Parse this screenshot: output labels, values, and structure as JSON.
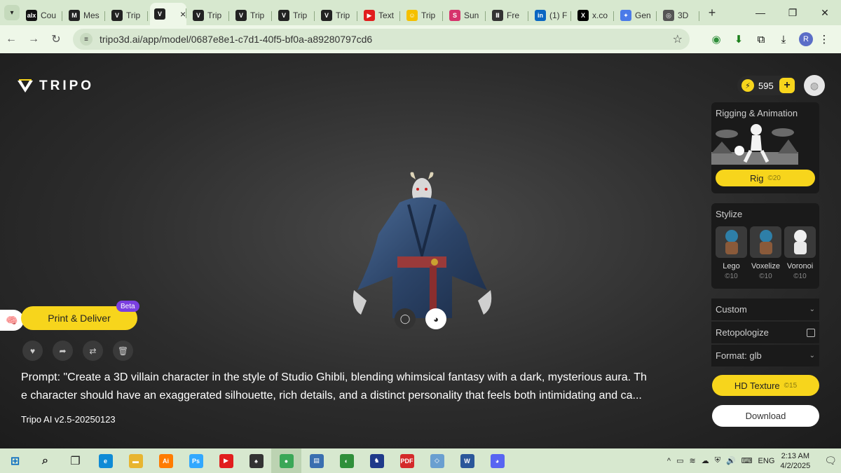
{
  "browser": {
    "tabs": [
      {
        "label": "Cou",
        "favicon": "alx",
        "color": "#111111"
      },
      {
        "label": "Mes",
        "favicon": "M",
        "color": "#222222"
      },
      {
        "label": "Trip",
        "favicon": "V",
        "color": "#222222"
      },
      {
        "label": "",
        "favicon": "V",
        "color": "#222222",
        "active": true
      },
      {
        "label": "Trip",
        "favicon": "V",
        "color": "#222222"
      },
      {
        "label": "Trip",
        "favicon": "V",
        "color": "#222222"
      },
      {
        "label": "Trip",
        "favicon": "V",
        "color": "#222222"
      },
      {
        "label": "Trip",
        "favicon": "V",
        "color": "#222222"
      },
      {
        "label": "Text",
        "favicon": "▶",
        "color": "#e11d1d"
      },
      {
        "label": "Trip",
        "favicon": "☺",
        "color": "#f5c000"
      },
      {
        "label": "Sun",
        "favicon": "S",
        "color": "#d6336c"
      },
      {
        "label": "Fre",
        "favicon": "Ⅱ",
        "color": "#333333"
      },
      {
        "label": "(1) F",
        "favicon": "in",
        "color": "#0a66c2"
      },
      {
        "label": "x.co",
        "favicon": "X",
        "color": "#000000"
      },
      {
        "label": "Gen",
        "favicon": "✦",
        "color": "#4a7ae8"
      },
      {
        "label": "3D",
        "favicon": "◎",
        "color": "#555555"
      }
    ],
    "tab_close": "×",
    "new_tab": "+",
    "url": "tripo3d.ai/app/model/0687e8e1-c7d1-40f5-bf0a-a89280797cd6",
    "profile_initial": "R"
  },
  "app": {
    "logo_text": "TRIPO",
    "credits": "595",
    "plus_label": "+",
    "rigging": {
      "title": "Rigging & Animation",
      "button": "Rig",
      "cost": "©20"
    },
    "stylize": {
      "title": "Stylize",
      "items": [
        {
          "label": "Lego",
          "cost": "©10"
        },
        {
          "label": "Voxelize",
          "cost": "©10"
        },
        {
          "label": "Voronoi",
          "cost": "©10"
        }
      ]
    },
    "custom_label": "Custom",
    "retopologize_label": "Retopologize",
    "format_label": "Format: glb",
    "hd_texture": {
      "label": "HD Texture",
      "cost": "©15"
    },
    "download_label": "Download",
    "print_deliver_label": "Print & Deliver",
    "beta_label": "Beta",
    "prompt_line1": "Prompt: \"Create a 3D villain character in the style of Studio Ghibli, blending whimsical fantasy with a dark, mysterious aura. Th",
    "prompt_line2": "e character should have an exaggerated silhouette, rich details, and a distinct personality that feels both intimidating and ca...",
    "version": "Tripo AI v2.5-20250123"
  },
  "taskbar": {
    "items": [
      {
        "icon": "windows-icon",
        "glyph": "⊞",
        "color": "#0067c0"
      },
      {
        "icon": "search-icon",
        "glyph": "⌕",
        "color": "#222222"
      },
      {
        "icon": "task-view-icon",
        "glyph": "❐",
        "color": "#222222"
      },
      {
        "icon": "edge-icon",
        "glyph": "e",
        "color": "#0f8bd6"
      },
      {
        "icon": "file-explorer-icon",
        "glyph": "▬",
        "color": "#e8b530"
      },
      {
        "icon": "illustrator-icon",
        "glyph": "Ai",
        "color": "#ff7c00"
      },
      {
        "icon": "photoshop-icon",
        "glyph": "Ps",
        "color": "#31a8ff"
      },
      {
        "icon": "youtube-icon",
        "glyph": "▶",
        "color": "#e11d1d"
      },
      {
        "icon": "solitaire-icon",
        "glyph": "♠",
        "color": "#333333"
      },
      {
        "icon": "chrome-icon",
        "glyph": "●",
        "color": "#3aa757",
        "active": true
      },
      {
        "icon": "document-icon",
        "glyph": "▤",
        "color": "#3a6fb0"
      },
      {
        "icon": "earth-icon",
        "glyph": "◐",
        "color": "#2f8f3a"
      },
      {
        "icon": "chess-icon",
        "glyph": "♞",
        "color": "#1f3a8a"
      },
      {
        "icon": "pdf-icon",
        "glyph": "PDF",
        "color": "#d42a2a"
      },
      {
        "icon": "tablet-icon",
        "glyph": "◇",
        "color": "#6a9fd0"
      },
      {
        "icon": "word-icon",
        "glyph": "W",
        "color": "#2b579a"
      },
      {
        "icon": "discord-icon",
        "glyph": "◕",
        "color": "#5865f2"
      }
    ],
    "language": "ENG",
    "time": "2:13 AM",
    "date": "4/2/2025"
  }
}
